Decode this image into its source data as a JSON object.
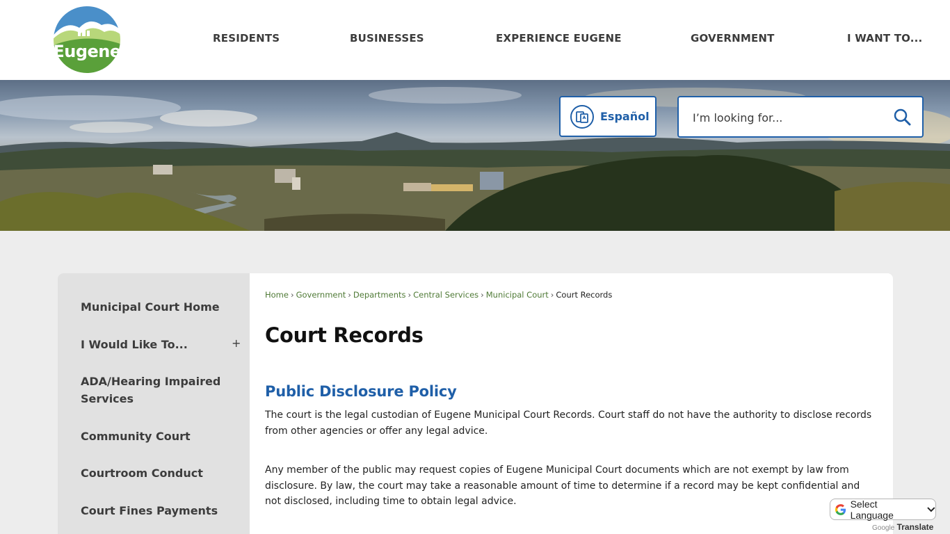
{
  "logo": {
    "text": "Eugene"
  },
  "nav": {
    "items": [
      {
        "label": "RESIDENTS"
      },
      {
        "label": "BUSINESSES"
      },
      {
        "label": "EXPERIENCE EUGENE"
      },
      {
        "label": "GOVERNMENT"
      },
      {
        "label": "I WANT TO..."
      }
    ]
  },
  "language": {
    "label": "Español"
  },
  "search": {
    "placeholder": "I’m looking for..."
  },
  "sidebar": {
    "items": [
      {
        "label": "Municipal Court Home"
      },
      {
        "label": "I Would Like To..."
      },
      {
        "label": "ADA/Hearing Impaired Services"
      },
      {
        "label": "Community Court"
      },
      {
        "label": "Courtroom Conduct"
      },
      {
        "label": "Court Fines Payments"
      }
    ],
    "expand_symbol": "+"
  },
  "breadcrumb": {
    "links": [
      "Home",
      "Government",
      "Departments",
      "Central Services",
      "Municipal Court"
    ],
    "separator": "›",
    "current": "Court Records"
  },
  "page": {
    "title": "Court Records",
    "section_title": "Public Disclosure Policy",
    "paragraphs": [
      "The court is the legal custodian of Eugene Municipal Court Records. Court staff do not have the authority to disclose records from other agencies or offer any legal advice.",
      "Any member of the public may request copies of Eugene Municipal Court documents which are not exempt by law from disclosure. By law, the court may take a reasonable amount of time to determine if a record may be kept confidential and not disclosed, including time to obtain legal advice."
    ]
  },
  "translate": {
    "select_label": "Select Language",
    "powered_prefix": "Google",
    "powered_label": "Translate"
  },
  "colors": {
    "accent_blue": "#1f5fa8",
    "breadcrumb_green": "#4f7a36",
    "logo_green": "#5aa03a"
  },
  "icons": {
    "language": "translate-icon",
    "search": "search-icon",
    "google": "google-g-icon"
  }
}
